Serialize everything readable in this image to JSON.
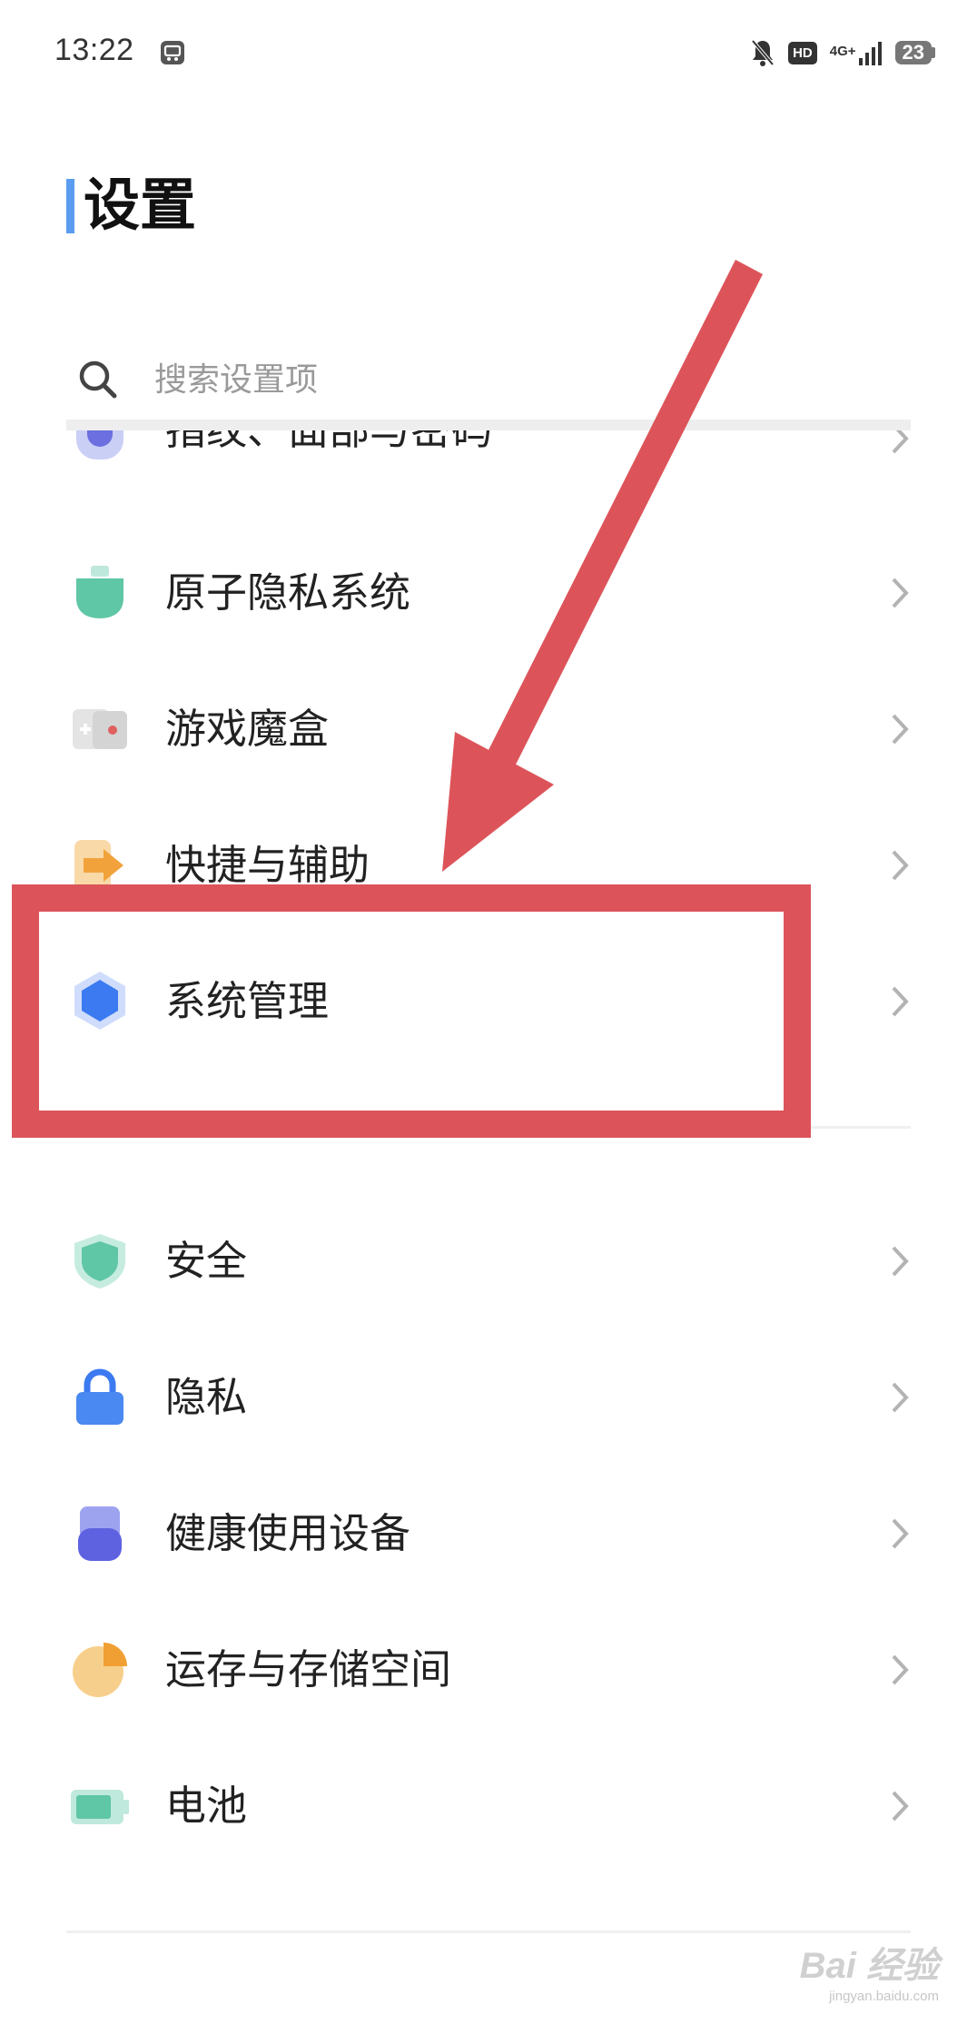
{
  "status_bar": {
    "time": "13:22",
    "network": "4G+",
    "hd": "HD",
    "battery": "23",
    "icons": [
      "app-notification-icon",
      "mute-bell-icon",
      "signal-icon",
      "battery-icon"
    ]
  },
  "page": {
    "title": "设置",
    "accent": "#5a9cf0"
  },
  "search": {
    "placeholder": "搜索设置项",
    "value": ""
  },
  "settings_partial": {
    "label": "指纹、面部与密码",
    "icon": "fingerprint-icon"
  },
  "settings_group_1": [
    {
      "label": "原子隐私系统",
      "icon": "atom-privacy-icon"
    },
    {
      "label": "游戏魔盒",
      "icon": "game-box-icon"
    },
    {
      "label": "快捷与辅助",
      "icon": "shortcut-icon"
    },
    {
      "label": "系统管理",
      "icon": "system-management-icon"
    }
  ],
  "settings_group_2": [
    {
      "label": "安全",
      "icon": "shield-icon"
    },
    {
      "label": "隐私",
      "icon": "lock-icon"
    },
    {
      "label": "健康使用设备",
      "icon": "health-use-icon"
    },
    {
      "label": "运存与存储空间",
      "icon": "storage-pie-icon"
    },
    {
      "label": "电池",
      "icon": "battery-setting-icon"
    }
  ],
  "annotation": {
    "highlighted_item": "系统管理",
    "color": "#dc545a"
  },
  "watermark": {
    "brand": "Bai 经验",
    "site": "jingyan.baidu.com"
  }
}
